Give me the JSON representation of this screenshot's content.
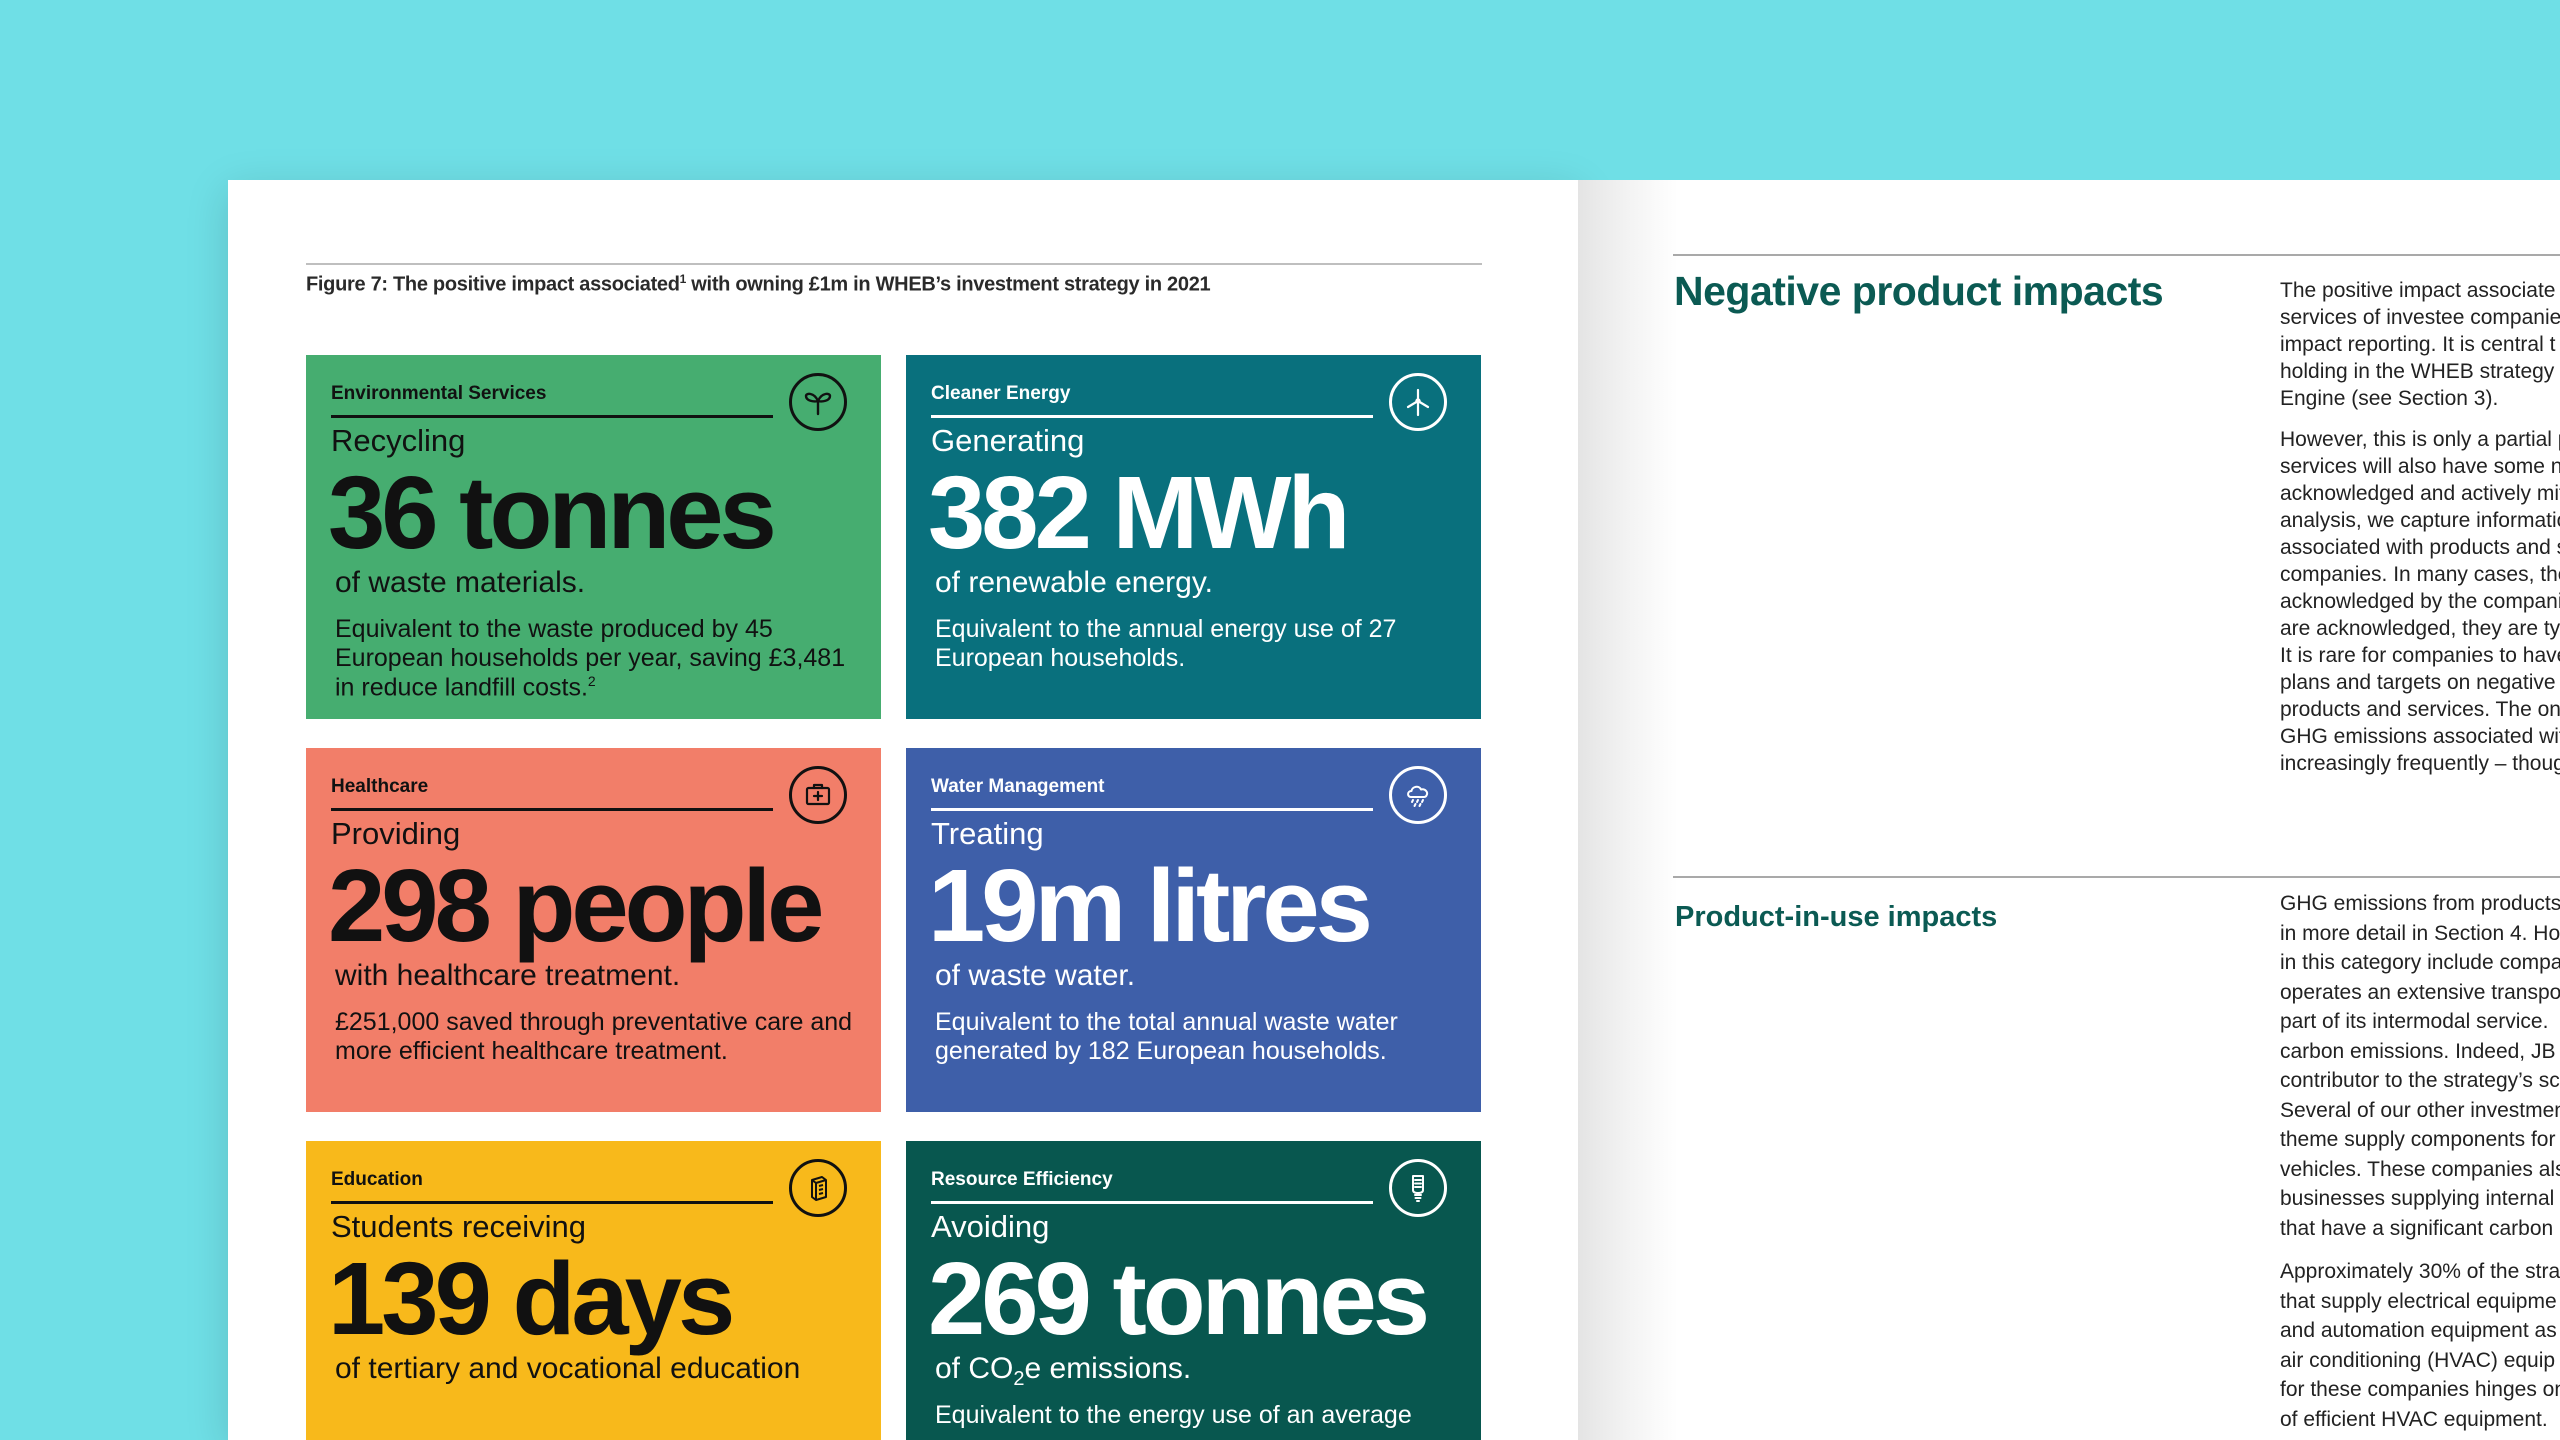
{
  "figure": {
    "caption": "Figure 7: The positive impact associated",
    "caption_sup": "1",
    "caption_rest": " with owning £1m in WHEB’s investment strategy in 2021"
  },
  "cards": [
    {
      "category": "Environmental Services",
      "icon": "sprout-icon",
      "verb": "Recycling",
      "big": "36 tonnes",
      "sub": "of waste materials.",
      "desc": "Equivalent to the waste produced by 45 European households per year, saving £3,481 in reduce landfill costs.",
      "desc_sup": "2",
      "color": "#46ad70"
    },
    {
      "category": "Cleaner Energy",
      "icon": "wind-turbine-icon",
      "verb": "Generating",
      "big": "382 MWh",
      "sub": "of renewable energy.",
      "desc": "Equivalent to the annual energy use of 27 European households.",
      "color": "#09707d"
    },
    {
      "category": "Healthcare",
      "icon": "medical-kit-icon",
      "verb": "Providing",
      "big": "298 people",
      "sub": "with healthcare treatment.",
      "desc": "£251,000 saved through preventative care and more efficient healthcare treatment.",
      "color": "#f27e69"
    },
    {
      "category": "Water Management",
      "icon": "rain-cloud-icon",
      "verb": "Treating",
      "big": "19m litres",
      "sub": "of waste water.",
      "desc": "Equivalent to the total annual waste water generated by 182 European households.",
      "color": "#3e5fa9"
    },
    {
      "category": "Education",
      "icon": "book-icon",
      "verb": "Students receiving",
      "big": "139 days",
      "sub": "of tertiary and vocational education",
      "color": "#f8b91b"
    },
    {
      "category": "Resource Efficiency",
      "icon": "light-bulb-icon",
      "verb": "Avoiding",
      "big": "269 tonnes",
      "sub_pre": "of CO",
      "sub_sub": "2",
      "sub_post": "e emissions.",
      "desc": "Equivalent to the energy use of an average",
      "color": "#08574f"
    }
  ],
  "right_page": {
    "heading1": "Negative product impacts",
    "heading2": "Product-in-use impacts",
    "section1": [
      [
        "The positive impact associate",
        "services of investee companie",
        "impact reporting. It is central t",
        "holding in the WHEB strategy",
        "Engine (see Section 3)."
      ],
      [
        "However, this is only a partial p",
        "services will also have some ne",
        "acknowledged and actively mit",
        "analysis, we capture informatio",
        "associated with products and s",
        "companies. In many cases, the",
        "acknowledged by the compani",
        "are acknowledged, they are typ",
        "It is rare for companies to have",
        "plans and targets on negative i",
        "products and services. The onl",
        "GHG emissions associated wit",
        "increasingly frequently – thoug"
      ]
    ],
    "section2": [
      [
        "GHG emissions from products",
        "in more detail in Section 4. Ho",
        "in this category include compa",
        "operates an extensive transpo",
        "part of its intermodal service.",
        "carbon emissions. Indeed, JB I",
        "contributor to the strategy’s sc",
        "Several of our other investmen",
        "theme supply components for",
        "vehicles. These companies als",
        "businesses supplying internal",
        "that have a significant carbon"
      ],
      [
        "Approximately 30% of the stra",
        "that supply electrical equipme",
        "and automation equipment as",
        "air conditioning (HVAC) equip",
        "for these companies hinges on",
        "of efficient HVAC equipment."
      ]
    ]
  }
}
